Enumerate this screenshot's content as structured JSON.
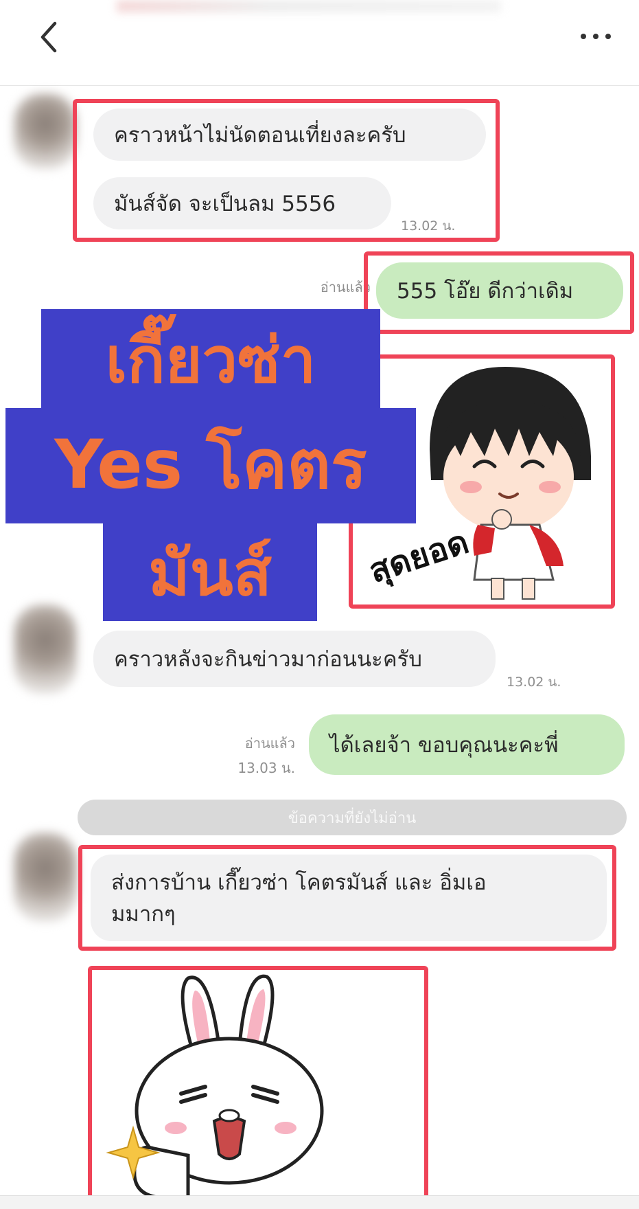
{
  "header": {
    "back_icon": "chevron-left-icon",
    "more_icon": "more-horizontal-icon"
  },
  "messages": {
    "m1": "คราวหน้าไม่นัดตอนเที่ยงละครับ",
    "m2": "มันส์จัด จะเป็นลม 5556",
    "m2_time": "13.02 น.",
    "m3_read": "อ่านแล้ว",
    "m3": "555 โอ๊ย ดีกว่าเดิม",
    "sticker1_caption": "สุดยอด",
    "m4": "คราวหลังจะกินข่าวมาก่อนนะครับ",
    "m4_time": "13.02 น.",
    "m5_read": "อ่านแล้ว",
    "m5_time": "13.03 น.",
    "m5": "ได้เลยจ้า ขอบคุณนะคะพี่",
    "unread_divider": "ข้อความที่ยังไม่อ่าน",
    "m6_line1": "ส่งการบ้าน เกี๊ยวซ่า โคตรมันส์ และ อิ่มเอ",
    "m6_line2": "มมากๆ"
  },
  "overlay": {
    "line1": "เกี๊ยวซ่า",
    "line2": "Yes โคตร",
    "line3": "มันส์"
  },
  "colors": {
    "highlight_border": "#ef4357",
    "overlay_bg": "#4040c8",
    "overlay_text": "#f1733b",
    "my_bubble": "#c9ebbf",
    "their_bubble": "#f1f1f2"
  }
}
